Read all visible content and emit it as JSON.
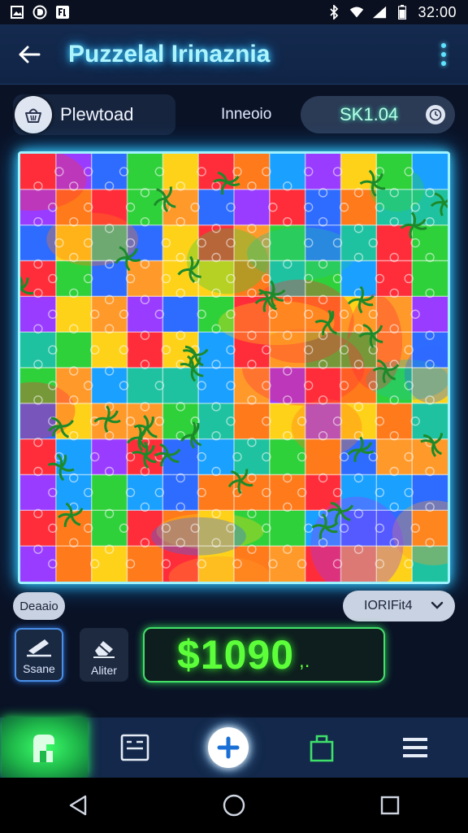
{
  "status_bar": {
    "time": "32:00"
  },
  "app_bar": {
    "title": "Puzzelal Irinaznia"
  },
  "info": {
    "playboard_label": "Plewtoad",
    "mode_label": "Inneoio",
    "score_value": "SK1.04"
  },
  "board": {
    "rows": 12,
    "cols": 12
  },
  "controls": {
    "left_dropdown": "Deaaio",
    "right_dropdown": "IORIFit4",
    "save_label": "Ssane",
    "filter_label": "Aliter",
    "money_value": "$1090",
    "money_tail": ",."
  },
  "colors": {
    "accent_cyan": "#5fe3ff",
    "money_green": "#5dff3a",
    "home_green": "#2bff62",
    "board_border": "#9ff3ff"
  },
  "icons": {
    "status": [
      "image-icon",
      "circle-d-icon",
      "app-icon",
      "bluetooth-icon",
      "wifi-icon",
      "signal-icon",
      "battery-icon"
    ],
    "bottom_nav": [
      "home-puzzle-icon",
      "board-icon",
      "add-icon",
      "bag-icon",
      "list-icon"
    ]
  }
}
